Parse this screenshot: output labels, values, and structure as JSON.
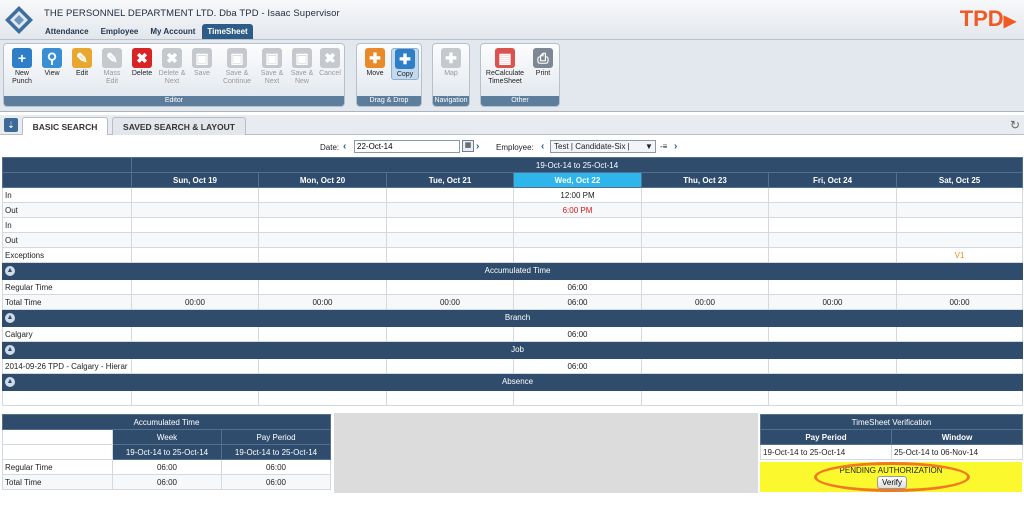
{
  "header": {
    "company": "THE PERSONNEL DEPARTMENT LTD. Dba TPD - Isaac Supervisor",
    "brand": "TPD",
    "menu": [
      "Attendance",
      "Employee",
      "My Account",
      "TimeSheet"
    ]
  },
  "ribbon": {
    "editor_label": "Editor",
    "dragdrop_label": "Drag & Drop",
    "navigation_label": "Navigation",
    "other_label": "Other",
    "buttons": {
      "new_punch": "New Punch",
      "view": "View",
      "edit": "Edit",
      "mass_edit": "Mass Edit",
      "delete": "Delete",
      "delete_next": "Delete & Next",
      "save": "Save",
      "save_continue": "Save & Continue",
      "save_next": "Save & Next",
      "save_new": "Save & New",
      "cancel": "Cancel",
      "move": "Move",
      "copy": "Copy",
      "map": "Map",
      "recalculate": "ReCalculate TimeSheet",
      "print": "Print"
    }
  },
  "tabs": [
    "BASIC SEARCH",
    "SAVED SEARCH & LAYOUT"
  ],
  "filters": {
    "date_label": "Date:",
    "date_value": "22-Oct-14",
    "employee_label": "Employee:",
    "employee_value": "Test | Candidate-Six |"
  },
  "grid": {
    "range": "19-Oct-14 to 25-Oct-14",
    "days": [
      "Sun, Oct 19",
      "Mon, Oct 20",
      "Tue, Oct 21",
      "Wed, Oct 22",
      "Thu, Oct 23",
      "Fri, Oct 24",
      "Sat, Oct 25"
    ],
    "rows": {
      "in1": {
        "label": "In",
        "wed": "12:00 PM"
      },
      "out1": {
        "label": "Out",
        "wed": "6:00 PM"
      },
      "in2": {
        "label": "In"
      },
      "out2": {
        "label": "Out"
      },
      "exceptions": {
        "label": "Exceptions",
        "sat": "V1"
      }
    },
    "accumulated_title": "Accumulated Time",
    "regular_label": "Regular Time",
    "regular_wed": "06:00",
    "total_label": "Total Time",
    "total_values": [
      "00:00",
      "00:00",
      "00:00",
      "06:00",
      "00:00",
      "00:00",
      "00:00"
    ],
    "branch_title": "Branch",
    "branch_label": "Calgary",
    "branch_wed": "06:00",
    "job_title": "Job",
    "job_label": "2014-09-26 TPD - Calgary - Hierar",
    "job_wed": "06:00",
    "absence_title": "Absence"
  },
  "accumulated": {
    "title": "Accumulated Time",
    "col_week": "Week",
    "col_pay": "Pay Period",
    "week_range": "19-Oct-14 to 25-Oct-14",
    "pay_range": "19-Oct-14 to 25-Oct-14",
    "regular_label": "Regular Time",
    "regular_week": "06:00",
    "regular_pay": "06:00",
    "total_label": "Total Time",
    "total_week": "06:00",
    "total_pay": "06:00"
  },
  "verification": {
    "title": "TimeSheet Verification",
    "col_pay": "Pay Period",
    "col_window": "Window",
    "pay_value": "19-Oct-14 to 25-Oct-14",
    "window_value": "25-Oct-14 to 06-Nov-14",
    "status": "PENDING AUTHORIZATION",
    "verify": "Verify"
  },
  "colors": {
    "accent": "#2f4c6d",
    "today": "#2eb6ec",
    "brand": "#f15a22",
    "pending": "#fbf92d",
    "highlight": "#f07a24"
  }
}
